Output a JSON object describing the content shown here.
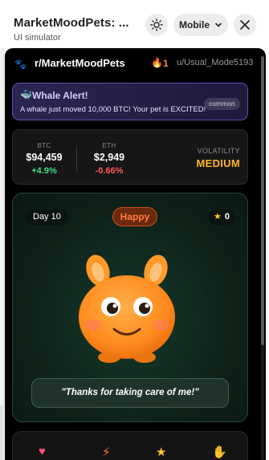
{
  "header": {
    "title": "MarketMoodPets: ...",
    "subtitle": "UI simulator",
    "device_label": "Mobile"
  },
  "app": {
    "subreddit": "r/MarketMoodPets",
    "streak": "1",
    "username": "u/Usual_Mode5193"
  },
  "alert": {
    "title": "Whale Alert!",
    "message": "A whale just moved 10,000 BTC! Your pet is EXCITED!",
    "badge": "common"
  },
  "market": {
    "btc": {
      "label": "BTC",
      "price": "$94,459",
      "change": "+4.9%"
    },
    "eth": {
      "label": "ETH",
      "price": "$2,949",
      "change": "-0.66%"
    },
    "volatility_label": "VOLATILITY",
    "volatility_value": "MEDIUM"
  },
  "pet": {
    "day": "Day 10",
    "mood": "Happy",
    "score": "0",
    "speech": "\"Thanks for taking care of me!\""
  },
  "colors": {
    "accent_orange": "#ff7b3a",
    "volatility": "#ffb72a",
    "positive": "#3ddc84",
    "negative": "#ff5a5a"
  }
}
